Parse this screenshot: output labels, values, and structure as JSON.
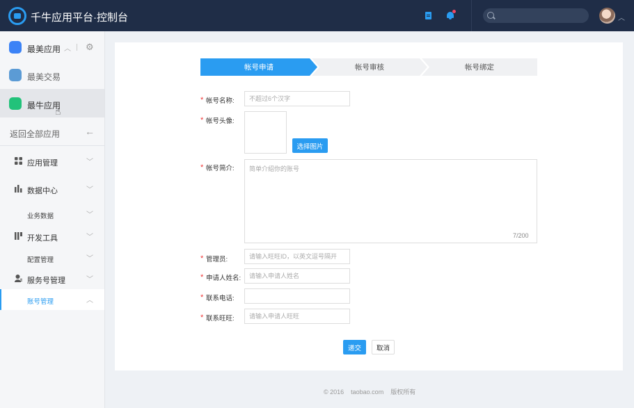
{
  "header": {
    "title": "千牛应用平台·控制台",
    "search_placeholder": ""
  },
  "sidebar": {
    "apps": [
      {
        "label": "最美应用",
        "color": "#3b82f6"
      },
      {
        "label": "最美交易",
        "color": "#5b9bd5"
      },
      {
        "label": "最牛应用",
        "color": "#22c27a"
      }
    ],
    "back_label": "返回全部应用",
    "nav": [
      {
        "label": "应用管理"
      },
      {
        "label": "数据中心"
      },
      {
        "label": "业务数据"
      },
      {
        "label": "开发工具"
      },
      {
        "label": "配置管理"
      },
      {
        "label": "服务号管理"
      },
      {
        "label": "账号管理"
      }
    ]
  },
  "steps": [
    "帐号申请",
    "帐号审核",
    "帐号绑定"
  ],
  "form": {
    "name_label": "帐号名称:",
    "name_placeholder": "不超过6个汉字",
    "avatar_label": "帐号头像:",
    "choose_image": "选择图片",
    "intro_label": "帐号简介:",
    "intro_placeholder": "简单介绍你的账号",
    "intro_counter": "7/200",
    "admin_label": "管理员:",
    "admin_placeholder": "请输入旺旺ID，以英文逗号隔开",
    "applicant_label": "申请人姓名:",
    "applicant_placeholder": "请输入申请人姓名",
    "phone_label": "联系电话:",
    "phone_placeholder": "",
    "wangwang_label": "联系旺旺:",
    "wangwang_placeholder": "请输入申请人旺旺",
    "submit": "递交",
    "cancel": "取消"
  },
  "footer": {
    "copyright": "© 2016",
    "site": "taobao.com",
    "rights": "版权所有"
  }
}
